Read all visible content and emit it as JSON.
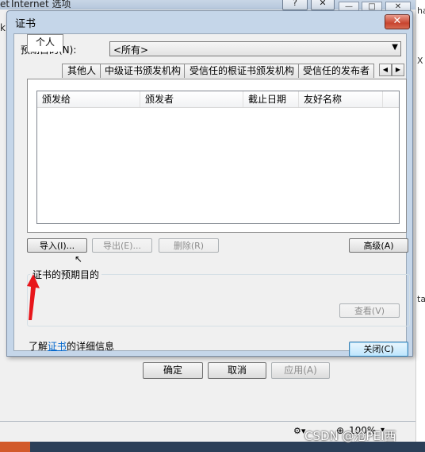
{
  "background_window": {
    "title": "Internet 选项",
    "left_edge_fragments": [
      "et",
      "k"
    ],
    "right_edge_fragments": [
      "ha",
      "X",
      "ta"
    ],
    "buttons": {
      "ok": "确定",
      "cancel": "取消",
      "apply": "应用(A)"
    },
    "zoom": "100%"
  },
  "dialog": {
    "title": "证书",
    "close_glyph": "✕",
    "purpose_label": "预期目的(N):",
    "purpose_value": "<所有>",
    "tabs": [
      "个人",
      "其他人",
      "中级证书颁发机构",
      "受信任的根证书颁发机构",
      "受信任的发布者"
    ],
    "tab_scroll_left": "◀",
    "tab_scroll_right": "▶",
    "columns": [
      "颁发给",
      "颁发者",
      "截止日期",
      "友好名称"
    ],
    "buttons": {
      "import": "导入(I)...",
      "export": "导出(E)...",
      "remove": "删除(R)",
      "advanced": "高级(A)",
      "view": "查看(V)",
      "close": "关闭(C)"
    },
    "group_title": "证书的预期目的",
    "info_prefix": "了解",
    "info_link": "证书",
    "info_suffix": "的详细信息"
  },
  "watermark": "CSDN @沧PEI西",
  "colors": {
    "arrow": "#e8161b",
    "link": "#0066cc",
    "title_bar": "#c5d6e9"
  }
}
